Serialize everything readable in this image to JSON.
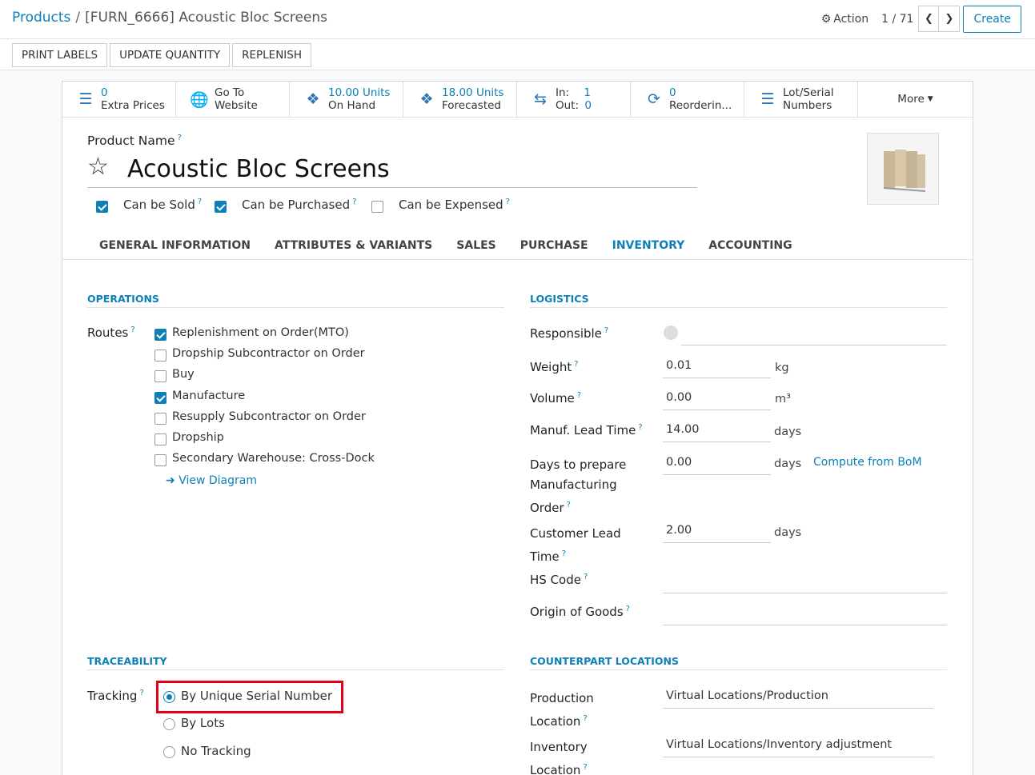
{
  "breadcrumb": {
    "parent": "Products",
    "separator": "/",
    "current": "[FURN_6666] Acoustic Bloc Screens"
  },
  "header": {
    "action_label": "Action",
    "pager": "1 / 71",
    "create_label": "Create"
  },
  "header_buttons": {
    "print_labels": "PRINT LABELS",
    "update_quantity": "UPDATE QUANTITY",
    "replenish": "REPLENISH"
  },
  "smart_buttons": {
    "extra_prices": {
      "value": "0",
      "label": "Extra Prices"
    },
    "website": {
      "line1": "Go To",
      "line2": "Website"
    },
    "on_hand": {
      "value": "10.00 Units",
      "label": "On Hand"
    },
    "forecasted": {
      "value": "18.00 Units",
      "label": "Forecasted"
    },
    "in_out": {
      "in_label": "In:",
      "in_value": "1",
      "out_label": "Out:",
      "out_value": "0"
    },
    "reordering": {
      "value": "0",
      "label": "Reorderin..."
    },
    "lots": {
      "line1": "Lot/Serial",
      "line2": "Numbers"
    },
    "more": "More"
  },
  "product": {
    "name_label": "Product Name",
    "name": "Acoustic Bloc Screens",
    "can_be_sold": "Can be Sold",
    "can_be_purchased": "Can be Purchased",
    "can_be_expensed": "Can be Expensed"
  },
  "tabs": [
    "GENERAL INFORMATION",
    "ATTRIBUTES & VARIANTS",
    "SALES",
    "PURCHASE",
    "INVENTORY",
    "ACCOUNTING"
  ],
  "operations": {
    "title": "OPERATIONS",
    "routes_label": "Routes",
    "routes": [
      {
        "label": "Replenishment on Order(MTO)",
        "checked": true
      },
      {
        "label": "Dropship Subcontractor on Order",
        "checked": false
      },
      {
        "label": "Buy",
        "checked": false
      },
      {
        "label": "Manufacture",
        "checked": true
      },
      {
        "label": "Resupply Subcontractor on Order",
        "checked": false
      },
      {
        "label": "Dropship",
        "checked": false
      },
      {
        "label": "Secondary Warehouse: Cross-Dock",
        "checked": false
      }
    ],
    "view_diagram": "View Diagram"
  },
  "logistics": {
    "title": "LOGISTICS",
    "responsible_label": "Responsible",
    "weight_label": "Weight",
    "weight": "0.01",
    "weight_unit": "kg",
    "volume_label": "Volume",
    "volume": "0.00",
    "volume_unit": "m³",
    "lead_label": "Manuf. Lead Time",
    "lead": "14.00",
    "lead_unit": "days",
    "prep_label_1": "Days to prepare",
    "prep_label_2": "Manufacturing",
    "prep_label_3": "Order",
    "prep": "0.00",
    "prep_unit": "days",
    "compute_bom": "Compute from BoM",
    "cust_label_1": "Customer Lead",
    "cust_label_2": "Time",
    "cust": "2.00",
    "cust_unit": "days",
    "hs_label": "HS Code",
    "origin_label": "Origin of Goods"
  },
  "traceability": {
    "title": "TRACEABILITY",
    "tracking_label": "Tracking",
    "options": [
      "By Unique Serial Number",
      "By Lots",
      "No Tracking"
    ],
    "selected": 0
  },
  "counterpart": {
    "title": "COUNTERPART LOCATIONS",
    "production_label_1": "Production",
    "production_label_2": "Location",
    "production_value": "Virtual Locations/Production",
    "inventory_label_1": "Inventory",
    "inventory_label_2": "Location",
    "inventory_value": "Virtual Locations/Inventory adjustment"
  }
}
